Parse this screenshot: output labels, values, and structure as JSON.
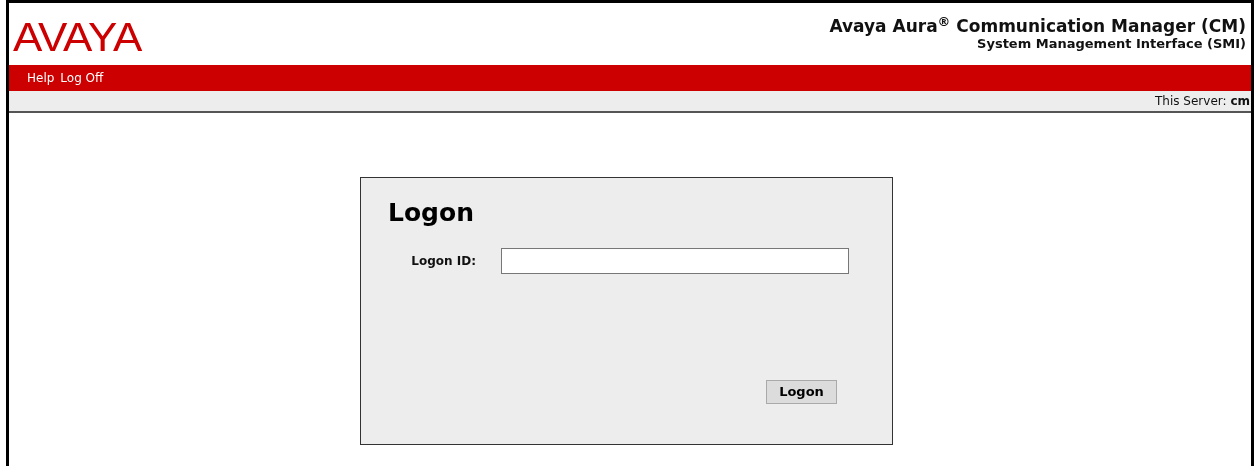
{
  "header": {
    "logo": "AVAYA",
    "title": "Avaya Aura$^{®}$ Communication Manager (CM)",
    "subtitle": "System Management Interface (SMI)"
  },
  "menu": [
    {
      "label": "Help"
    },
    {
      "label": "Log Off"
    }
  ],
  "server_info": "This Server: **cm**",
  "logon_panel": {
    "title": "Logon",
    "field_label": "Logon ID:",
    "button": "Logon"
  }
}
